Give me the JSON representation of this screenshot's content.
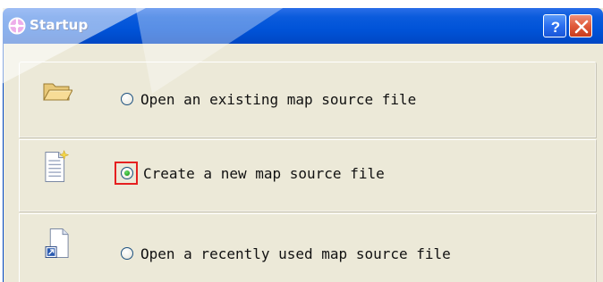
{
  "window": {
    "title": "Startup",
    "title_icon": "map-icon",
    "buttons": {
      "help_label": "?",
      "close_label": "X"
    }
  },
  "options": [
    {
      "label": "Open an existing map source file",
      "icon": "folder-open-icon",
      "selected": false
    },
    {
      "label": "Create a new map source file",
      "icon": "new-document-icon",
      "selected": true
    },
    {
      "label": "Open a recently used map source file",
      "icon": "recent-file-shortcut-icon",
      "selected": false
    }
  ],
  "colors": {
    "titlebar": "#0053d8",
    "dialog_background": "#ece9d8",
    "selected_radio": "#21a121",
    "focus_highlight": "#e52020"
  }
}
